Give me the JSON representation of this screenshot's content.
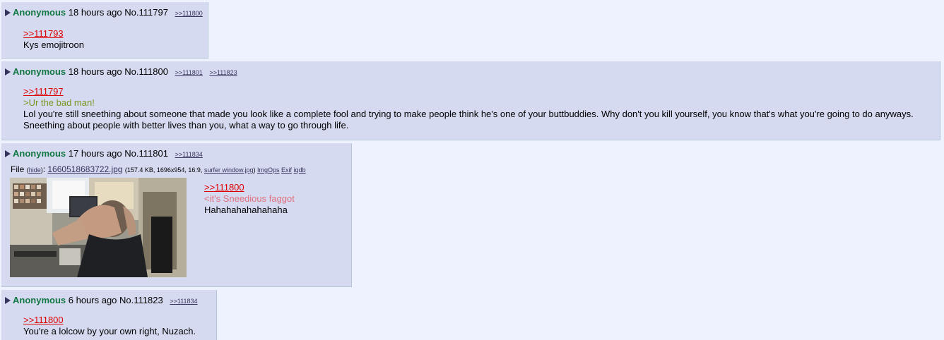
{
  "posts": [
    {
      "name": "Anonymous",
      "time": "18 hours ago",
      "no": "No.111797",
      "backlinks": [
        ">>111800"
      ],
      "quote": ">>111793",
      "text": [
        "Kys emojitroon"
      ]
    },
    {
      "name": "Anonymous",
      "time": "18 hours ago",
      "no": "No.111800",
      "backlinks": [
        ">>111801",
        ">>111823"
      ],
      "quote": ">>111797",
      "greentext": ">Ur the bad man!",
      "text": [
        "Lol you're still sneething about someone that made you look like a complete fool and trying to make people think he's one of your buttbuddies. Why don't you kill yourself, you know that's what you're going to do anyways.",
        "Sneething about people with better lives than you, what a way to go through life."
      ]
    },
    {
      "name": "Anonymous",
      "time": "17 hours ago",
      "no": "No.111801",
      "backlinks": [
        ">>111834"
      ],
      "file": {
        "prefix": "File",
        "hide": "hide",
        "filename": "1660518683722.jpg",
        "meta": "(157.4 KB, 1696x954, 16:9,",
        "orig": "surfer window.jpg",
        "meta_end": ")",
        "imgops": "ImgOps",
        "exif": "Exif",
        "iqdb": "iqdb"
      },
      "quote": ">>111800",
      "pinktext": "<it's Sneedious faggot",
      "text": [
        "Hahahahahahahaha"
      ]
    },
    {
      "name": "Anonymous",
      "time": "6 hours ago",
      "no": "No.111823",
      "backlinks": [
        ">>111834"
      ],
      "quote": ">>111800",
      "text": [
        "You're a lolcow by your own right, Nuzach."
      ]
    }
  ],
  "colors": {
    "background": "#eef2ff",
    "post": "#d6daf0",
    "name": "#117743",
    "quotelink": "#dd0000",
    "greentext": "#789922",
    "pinktext": "#e0727f"
  }
}
